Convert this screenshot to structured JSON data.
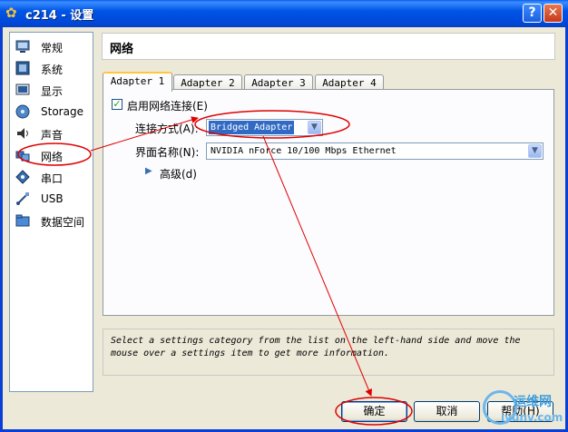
{
  "window": {
    "title": "c214 - 设置",
    "help_glyph": "?",
    "close_glyph": "✕",
    "icon": "gear-icon"
  },
  "sidebar": {
    "items": [
      {
        "label": "常规",
        "icon": "general-icon"
      },
      {
        "label": "系统",
        "icon": "system-icon"
      },
      {
        "label": "显示",
        "icon": "display-icon"
      },
      {
        "label": "Storage",
        "icon": "storage-icon"
      },
      {
        "label": "声音",
        "icon": "audio-icon"
      },
      {
        "label": "网络",
        "icon": "network-icon"
      },
      {
        "label": "串口",
        "icon": "serial-port-icon"
      },
      {
        "label": "USB",
        "icon": "usb-icon"
      },
      {
        "label": "数据空间",
        "icon": "shared-folder-icon"
      }
    ],
    "selected": "网络"
  },
  "main": {
    "section_title": "网络",
    "tabs": [
      {
        "label": "Adapter 1"
      },
      {
        "label": "Adapter 2"
      },
      {
        "label": "Adapter 3"
      },
      {
        "label": "Adapter 4"
      }
    ],
    "active_tab": "Adapter 1",
    "enable_checkbox": {
      "label": "启用网络连接(E)",
      "checked": true,
      "mark": "✓"
    },
    "attached_to": {
      "label": "连接方式(A):",
      "value": "Bridged Adapter"
    },
    "interface_name": {
      "label": "界面名称(N):",
      "value": "NVIDIA nForce 10/100 Mbps Ethernet"
    },
    "advanced": {
      "label": "高级(d)"
    },
    "description": "Select a settings category from the list on the left-hand side and move the mouse over a settings item to get more information."
  },
  "buttons": {
    "ok": "确定",
    "cancel": "取消",
    "help": "帮助(H)"
  },
  "watermark": {
    "line1": "运维网",
    "line2": "iyunv.com"
  },
  "colors": {
    "title_bar": "#0055e5",
    "annotation": "#e00000",
    "selection": "#316ac5"
  }
}
